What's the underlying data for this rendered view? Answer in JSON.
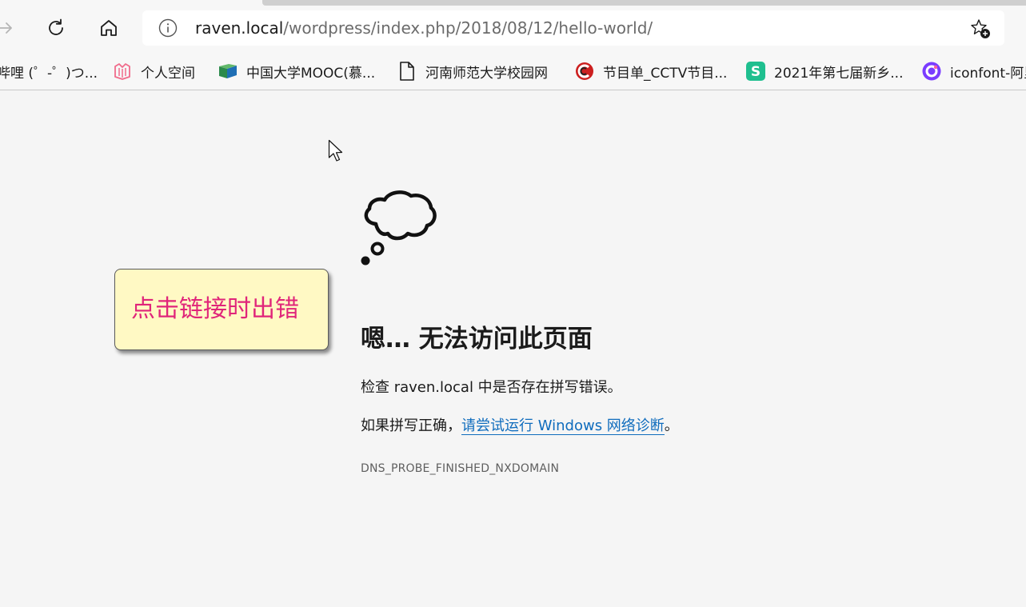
{
  "browser": {
    "address": {
      "host": "raven.local",
      "path": "/wordpress/index.php/2018/08/12/hello-world/"
    },
    "bookmarks": [
      {
        "label": "哔哩 (゜-゜)つ...",
        "icon": "bilibili-icon"
      },
      {
        "label": "个人空间",
        "icon": "personal-space-icon",
        "color": "#f06b8b"
      },
      {
        "label": "中国大学MOOC(慕...",
        "icon": "mooc-icon",
        "color": "#2c8a4b"
      },
      {
        "label": "河南师范大学校园网",
        "icon": "document-icon"
      },
      {
        "label": "节目单_CCTV节目...",
        "icon": "cctv-icon",
        "color": "#cc1f1f"
      },
      {
        "label": "2021年第七届新乡...",
        "icon": "s-icon",
        "color": "#1fbf8f"
      },
      {
        "label": "iconfont-阿里",
        "icon": "iconfont-icon",
        "color": "#7a3cff"
      }
    ]
  },
  "annotation": {
    "text": "点击链接时出错"
  },
  "error_page": {
    "title": "嗯… 无法访问此页面",
    "line1": "检查 raven.local 中是否存在拼写错误。",
    "line2_prefix": "如果拼写正确，",
    "line2_link": "请尝试运行 Windows 网络诊断",
    "line2_suffix": "。",
    "error_code": "DNS_PROBE_FINISHED_NXDOMAIN"
  },
  "colors": {
    "link": "#0f6cbd",
    "annotation_text": "#e0257a",
    "annotation_bg": "#fff9c4"
  }
}
